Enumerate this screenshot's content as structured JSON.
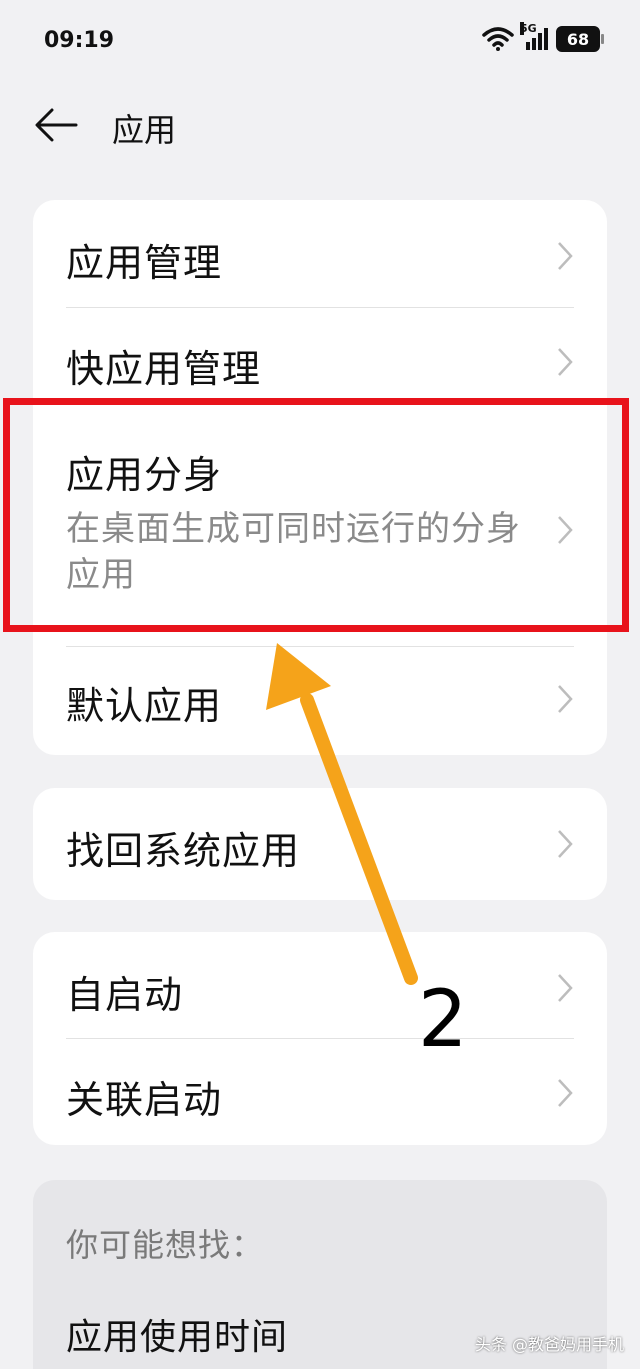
{
  "status": {
    "time": "09:19",
    "network": "5G",
    "battery": "68"
  },
  "header": {
    "title": "应用"
  },
  "group1": [
    {
      "label": "应用管理"
    },
    {
      "label": "快应用管理"
    },
    {
      "label": "应用分身",
      "subtitle": "在桌面生成可同时运行的分身应用"
    },
    {
      "label": "默认应用"
    }
  ],
  "group2": [
    {
      "label": "找回系统应用"
    }
  ],
  "group3": [
    {
      "label": "自启动"
    },
    {
      "label": "关联启动"
    }
  ],
  "suggestions": {
    "title": "你可能想找：",
    "items": [
      "应用使用时间"
    ]
  },
  "annotation": {
    "step": "2",
    "highlight_color": "#e8131b",
    "arrow_color": "#f5a31a"
  },
  "watermark": "头条 @教爸妈用手机"
}
